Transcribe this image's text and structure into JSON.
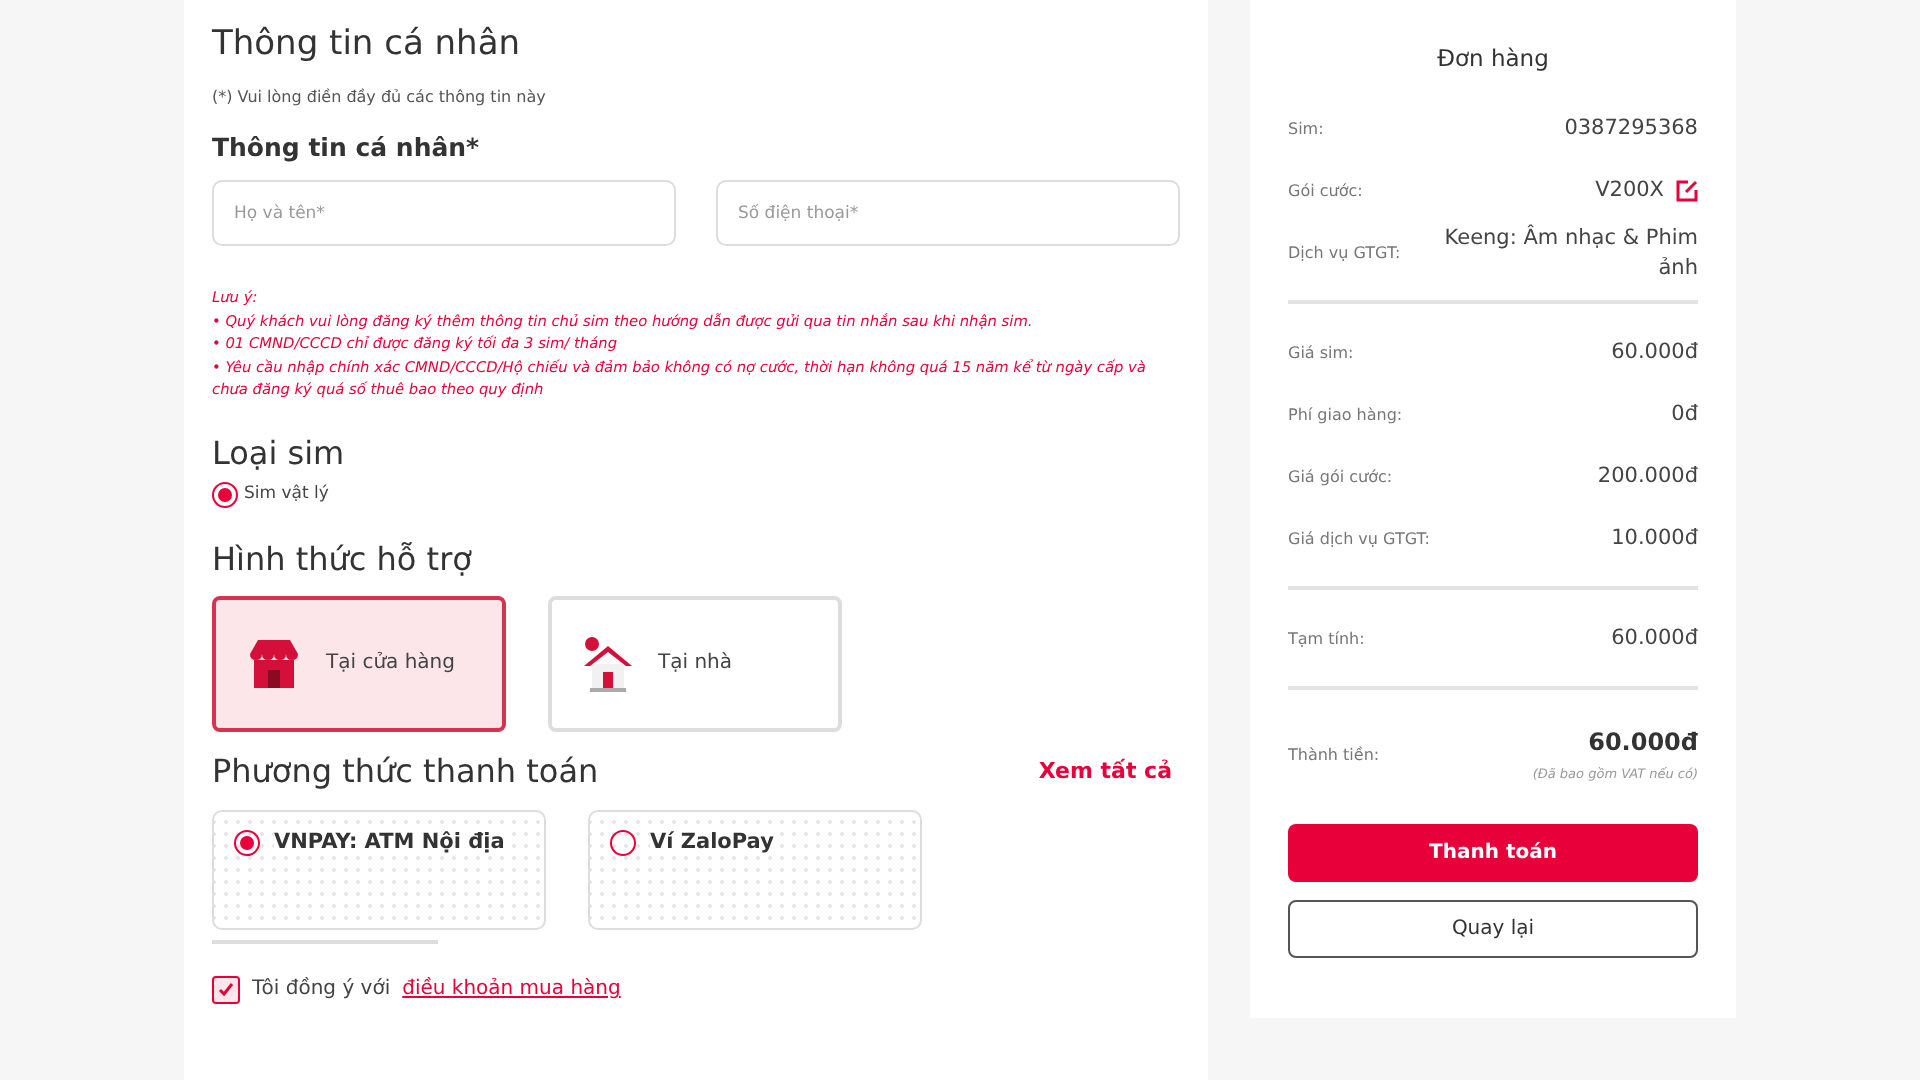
{
  "personal": {
    "title": "Thông tin cá nhân",
    "hint": "(*) Vui lòng điền đầy đủ các thông tin này",
    "subtitle": "Thông tin cá nhân*",
    "fields": [
      {
        "placeholder": "Họ và tên*"
      },
      {
        "placeholder": "Số điện thoại*"
      }
    ],
    "note_title": "Lưu ý:",
    "notes": [
      "• Quý khách vui lòng đăng ký thêm thông tin chủ sim theo hướng dẫn được gửi qua tin nhắn sau khi nhận sim.",
      "• 01 CMND/CCCD chỉ được đăng ký tối đa 3 sim/ tháng",
      "• Yêu cầu nhập chính xác CMND/CCCD/Hộ chiếu và đảm bảo không có nợ cước, thời hạn không quá 15 năm kể từ ngày cấp và chưa đăng ký quá số thuê bao theo quy định"
    ]
  },
  "sim_type": {
    "title": "Loại sim",
    "options": [
      {
        "label": "Sim vật lý",
        "selected": true
      }
    ]
  },
  "support": {
    "title": "Hình thức hỗ trợ",
    "options": [
      {
        "label": "Tại cửa hàng",
        "kind": "store",
        "selected": true
      },
      {
        "label": "Tại nhà",
        "kind": "home",
        "selected": false
      }
    ]
  },
  "payment": {
    "title": "Phương thức thanh toán",
    "see_all": "Xem tất cả",
    "options": [
      {
        "label": "VNPAY: ATM Nội địa",
        "selected": true
      },
      {
        "label": "Ví ZaloPay",
        "selected": false
      }
    ]
  },
  "agree": {
    "checked": true,
    "text": "Tôi đồng ý với",
    "link": "điều khoản mua hàng"
  },
  "order": {
    "title": "Đơn hàng",
    "groups": [
      [
        {
          "label": "Sim:",
          "value": "0387295368"
        },
        {
          "label": "Gói cước:",
          "value": "V200X",
          "editable": true
        },
        {
          "label": "Dịch vụ GTGT:",
          "value": "Keeng: Âm nhạc & Phim ảnh"
        }
      ],
      [
        {
          "label": "Giá sim:",
          "value": "60.000đ"
        },
        {
          "label": "Phí giao hàng:",
          "value": "0đ"
        },
        {
          "label": "Giá gói cước:",
          "value": "200.000đ"
        },
        {
          "label": "Giá dịch vụ GTGT:",
          "value": "10.000đ"
        }
      ],
      [
        {
          "label": "Tạm tính:",
          "value": "60.000đ"
        }
      ]
    ],
    "total": {
      "label": "Thành tiền:",
      "value": "60.000đ",
      "note": "(Đã bao gồm VAT nếu có)"
    },
    "buttons": [
      {
        "label": "Thanh toán",
        "kind": "primary"
      },
      {
        "label": "Quay lại",
        "kind": "secondary"
      }
    ]
  }
}
